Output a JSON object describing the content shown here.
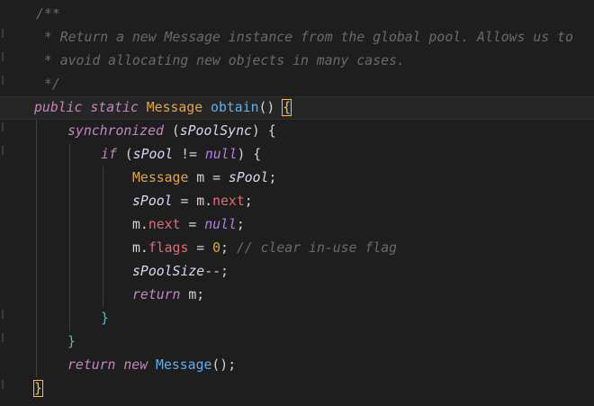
{
  "editor": {
    "lines": [
      {
        "tokens": [
          {
            "t": "/**",
            "c": "comment"
          }
        ]
      },
      {
        "tokens": [
          {
            "t": " * Return a new Message instance from the global pool. Allows us to",
            "c": "comment"
          }
        ]
      },
      {
        "tokens": [
          {
            "t": " * avoid allocating new objects in many cases.",
            "c": "comment"
          }
        ]
      },
      {
        "tokens": [
          {
            "t": " */",
            "c": "comment"
          }
        ]
      },
      {
        "tokens": [
          {
            "t": "public",
            "c": "kw"
          },
          {
            "t": " ",
            "c": "punc"
          },
          {
            "t": "static",
            "c": "kw"
          },
          {
            "t": " ",
            "c": "punc"
          },
          {
            "t": "Message",
            "c": "type"
          },
          {
            "t": " ",
            "c": "punc"
          },
          {
            "t": "obtain",
            "c": "fn"
          },
          {
            "t": "() ",
            "c": "punc"
          },
          {
            "t": "{",
            "c": "bracket"
          }
        ]
      },
      {
        "tokens": [
          {
            "t": "synchronized",
            "c": "kw"
          },
          {
            "t": " (",
            "c": "punc"
          },
          {
            "t": "sPoolSync",
            "c": "var"
          },
          {
            "t": ") {",
            "c": "punc"
          }
        ]
      },
      {
        "tokens": [
          {
            "t": "if",
            "c": "kw"
          },
          {
            "t": " (",
            "c": "punc"
          },
          {
            "t": "sPool",
            "c": "var"
          },
          {
            "t": " != ",
            "c": "op"
          },
          {
            "t": "null",
            "c": "const"
          },
          {
            "t": ") {",
            "c": "punc"
          }
        ]
      },
      {
        "tokens": [
          {
            "t": "Message",
            "c": "type"
          },
          {
            "t": " m = ",
            "c": "ident"
          },
          {
            "t": "sPool",
            "c": "var"
          },
          {
            "t": ";",
            "c": "punc"
          }
        ]
      },
      {
        "tokens": [
          {
            "t": "sPool",
            "c": "var"
          },
          {
            "t": " = m.",
            "c": "ident"
          },
          {
            "t": "next",
            "c": "field"
          },
          {
            "t": ";",
            "c": "punc"
          }
        ]
      },
      {
        "tokens": [
          {
            "t": "m.",
            "c": "ident"
          },
          {
            "t": "next",
            "c": "field"
          },
          {
            "t": " = ",
            "c": "op"
          },
          {
            "t": "null",
            "c": "const"
          },
          {
            "t": ";",
            "c": "punc"
          }
        ]
      },
      {
        "tokens": [
          {
            "t": "m.",
            "c": "ident"
          },
          {
            "t": "flags",
            "c": "field"
          },
          {
            "t": " = ",
            "c": "op"
          },
          {
            "t": "0",
            "c": "num"
          },
          {
            "t": "; ",
            "c": "punc"
          },
          {
            "t": "// clear in-use flag",
            "c": "comment"
          }
        ]
      },
      {
        "tokens": [
          {
            "t": "sPoolSize",
            "c": "var"
          },
          {
            "t": "--;",
            "c": "punc"
          }
        ]
      },
      {
        "tokens": [
          {
            "t": "return",
            "c": "kw"
          },
          {
            "t": " m;",
            "c": "ident"
          }
        ]
      },
      {
        "tokens": [
          {
            "t": "}",
            "c": "brace"
          }
        ]
      },
      {
        "tokens": [
          {
            "t": "}",
            "c": "brace"
          }
        ]
      },
      {
        "tokens": [
          {
            "t": "return",
            "c": "kw"
          },
          {
            "t": " ",
            "c": "punc"
          },
          {
            "t": "new",
            "c": "kw"
          },
          {
            "t": " ",
            "c": "punc"
          },
          {
            "t": "Message",
            "c": "fn"
          },
          {
            "t": "();",
            "c": "punc"
          }
        ]
      },
      {
        "tokens": [
          {
            "t": "}",
            "c": "bracket"
          }
        ]
      }
    ],
    "colors": {
      "background": "#1e1e1e",
      "comment": "#6a6a6a",
      "keyword": "#c586c0",
      "type": "#e5a448",
      "function": "#61afef",
      "field": "#e06c75",
      "constant": "#b77de8",
      "bracket_match": "#e5c07b"
    }
  }
}
